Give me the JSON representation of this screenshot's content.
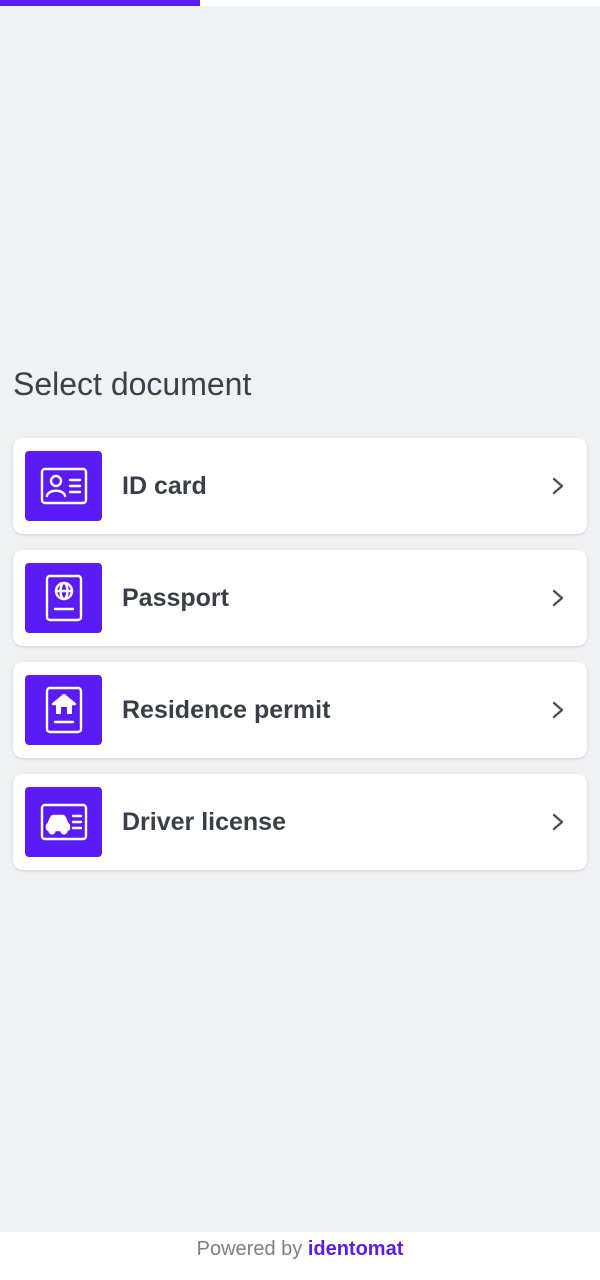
{
  "progress": {
    "fraction": 0.333,
    "color": "#5b1bf5"
  },
  "title": "Select document",
  "documents": [
    {
      "label": "ID card",
      "icon": "id-card-icon"
    },
    {
      "label": "Passport",
      "icon": "passport-icon"
    },
    {
      "label": "Residence permit",
      "icon": "residence-permit-icon"
    },
    {
      "label": "Driver license",
      "icon": "driver-license-icon"
    }
  ],
  "footer": {
    "prefix": "Powered by",
    "brand": "identomat"
  },
  "colors": {
    "accent": "#5b1bf5",
    "background": "#f0f1f2",
    "card": "#ffffff"
  }
}
